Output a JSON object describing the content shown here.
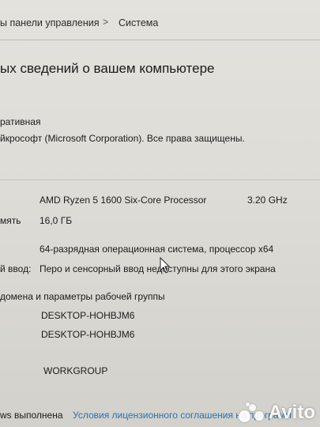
{
  "breadcrumb": {
    "parent": "ы панели управления",
    "separator": ">",
    "current": "Система"
  },
  "page_title": "ых сведений о вашем компьютере",
  "windows_edition": {
    "edition_fragment": "ративная",
    "copyright": "йкрософт (Microsoft Corporation). Все права защищены."
  },
  "system": {
    "processor_value": "AMD Ryzen 5 1600 Six-Core Processor",
    "processor_speed": "3.20 GHz",
    "memory_label": "мять",
    "memory_value": "16,0 ГБ",
    "system_type_value": "64-разрядная операционная система, процессор x64",
    "pen_label": "й ввод:",
    "pen_value": "Перо и сенсорный ввод недоступны для этого экрана"
  },
  "computer_name": {
    "section_title": "домена и параметры рабочей группы",
    "computer_name_value": "DESKTOP-HOHBJM6",
    "full_name_value": "DESKTOP-HOHBJM6",
    "workgroup_value": "WORKGROUP"
  },
  "activation": {
    "status_fragment": "ws выполнена",
    "license_link": "Условия лицензионного соглашения на программ"
  },
  "watermark": {
    "text": "Avito"
  },
  "colors": {
    "link": "#2b6fb3",
    "background": "#dddcd7"
  }
}
